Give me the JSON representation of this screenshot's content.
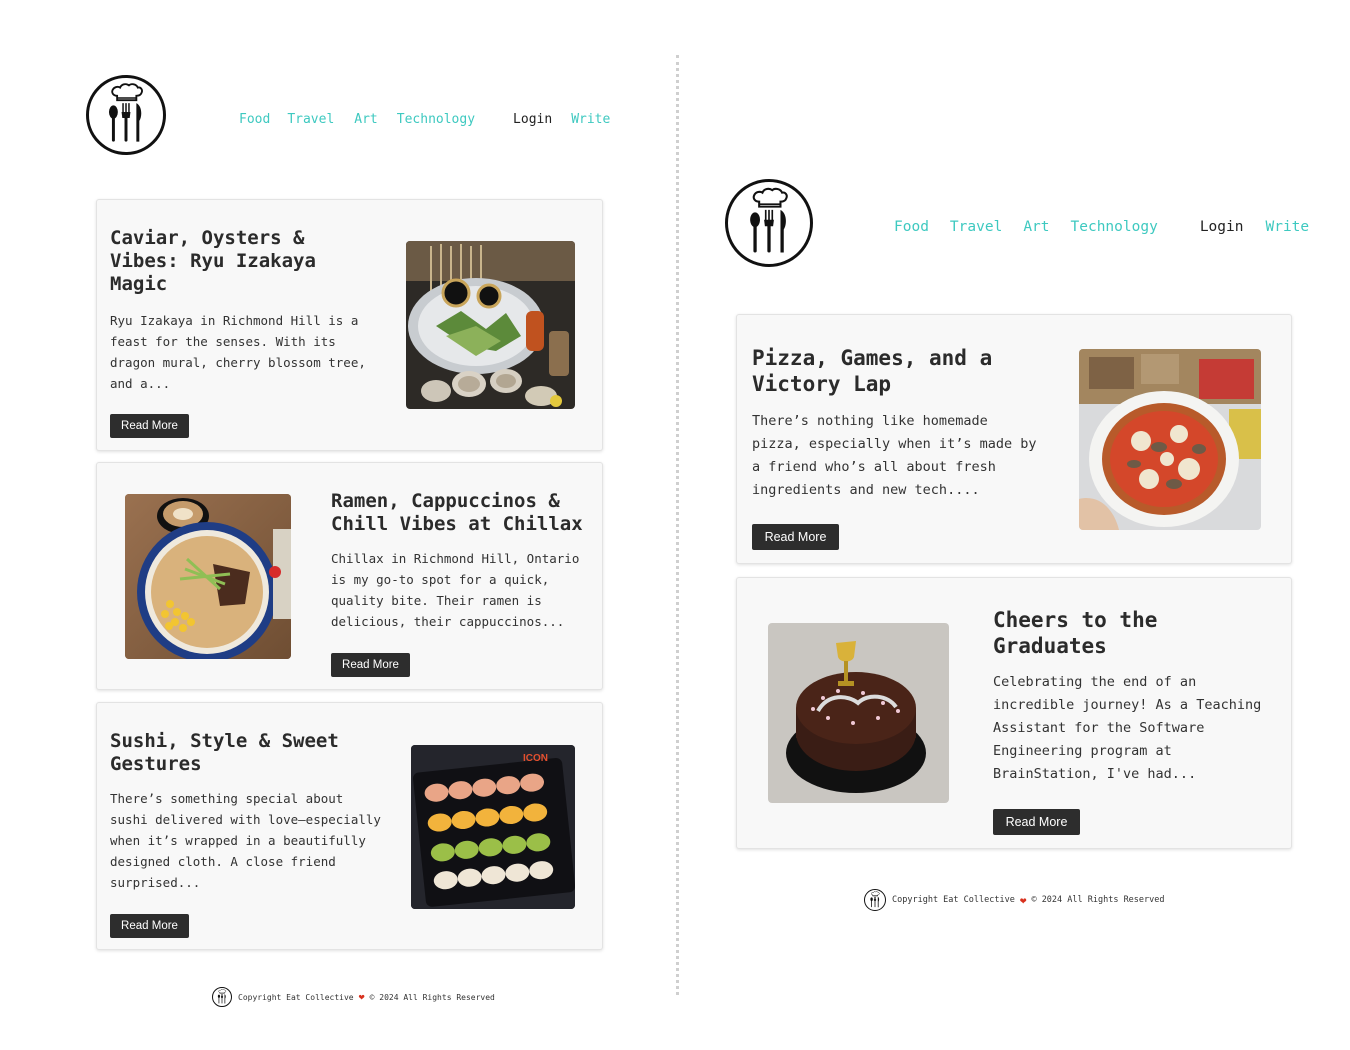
{
  "nav": {
    "links": [
      "Food",
      "Travel",
      "Art",
      "Technology"
    ],
    "login": "Login",
    "write": "Write"
  },
  "left": {
    "posts": [
      {
        "title": "Caviar, Oysters & Vibes: Ryu Izakaya Magic",
        "excerpt": "Ryu Izakaya in Richmond Hill is a feast for the senses. With its dragon mural, cherry blossom tree, and a...",
        "button": "Read More"
      },
      {
        "title": "Ramen, Cappuccinos & Chill Vibes at Chillax",
        "excerpt": "Chillax in Richmond Hill, Ontario is my go-to spot for a quick, quality bite. Their ramen is delicious, their cappuccinos...",
        "button": "Read More"
      },
      {
        "title": "Sushi, Style & Sweet Gestures",
        "excerpt": "There’s something special about sushi delivered with love—especially when it’s wrapped in a beautifully designed cloth. A close friend surprised...",
        "button": "Read More"
      }
    ]
  },
  "right": {
    "posts": [
      {
        "title": "Pizza, Games, and a Victory Lap",
        "excerpt": "There’s nothing like homemade pizza, especially when it’s made by a friend who’s all about fresh ingredients and new tech....",
        "button": "Read More"
      },
      {
        "title": "Cheers to the Graduates",
        "excerpt": "Celebrating the end of an incredible journey! As a Teaching Assistant for the Software Engineering program at BrainStation, I've had...",
        "button": "Read More"
      }
    ]
  },
  "footer": {
    "copyright": "Copyright Eat Collective",
    "heart": "❤",
    "rights": "© 2024 All Rights Reserved"
  },
  "icons": {
    "logo": "chef-hat-cutlery-icon",
    "heart": "heart-icon"
  },
  "colors": {
    "nav_link": "#3ec9c0",
    "button_bg": "#2d2d2d",
    "card_bg": "#f8f8f8",
    "heart": "#d8311e"
  }
}
